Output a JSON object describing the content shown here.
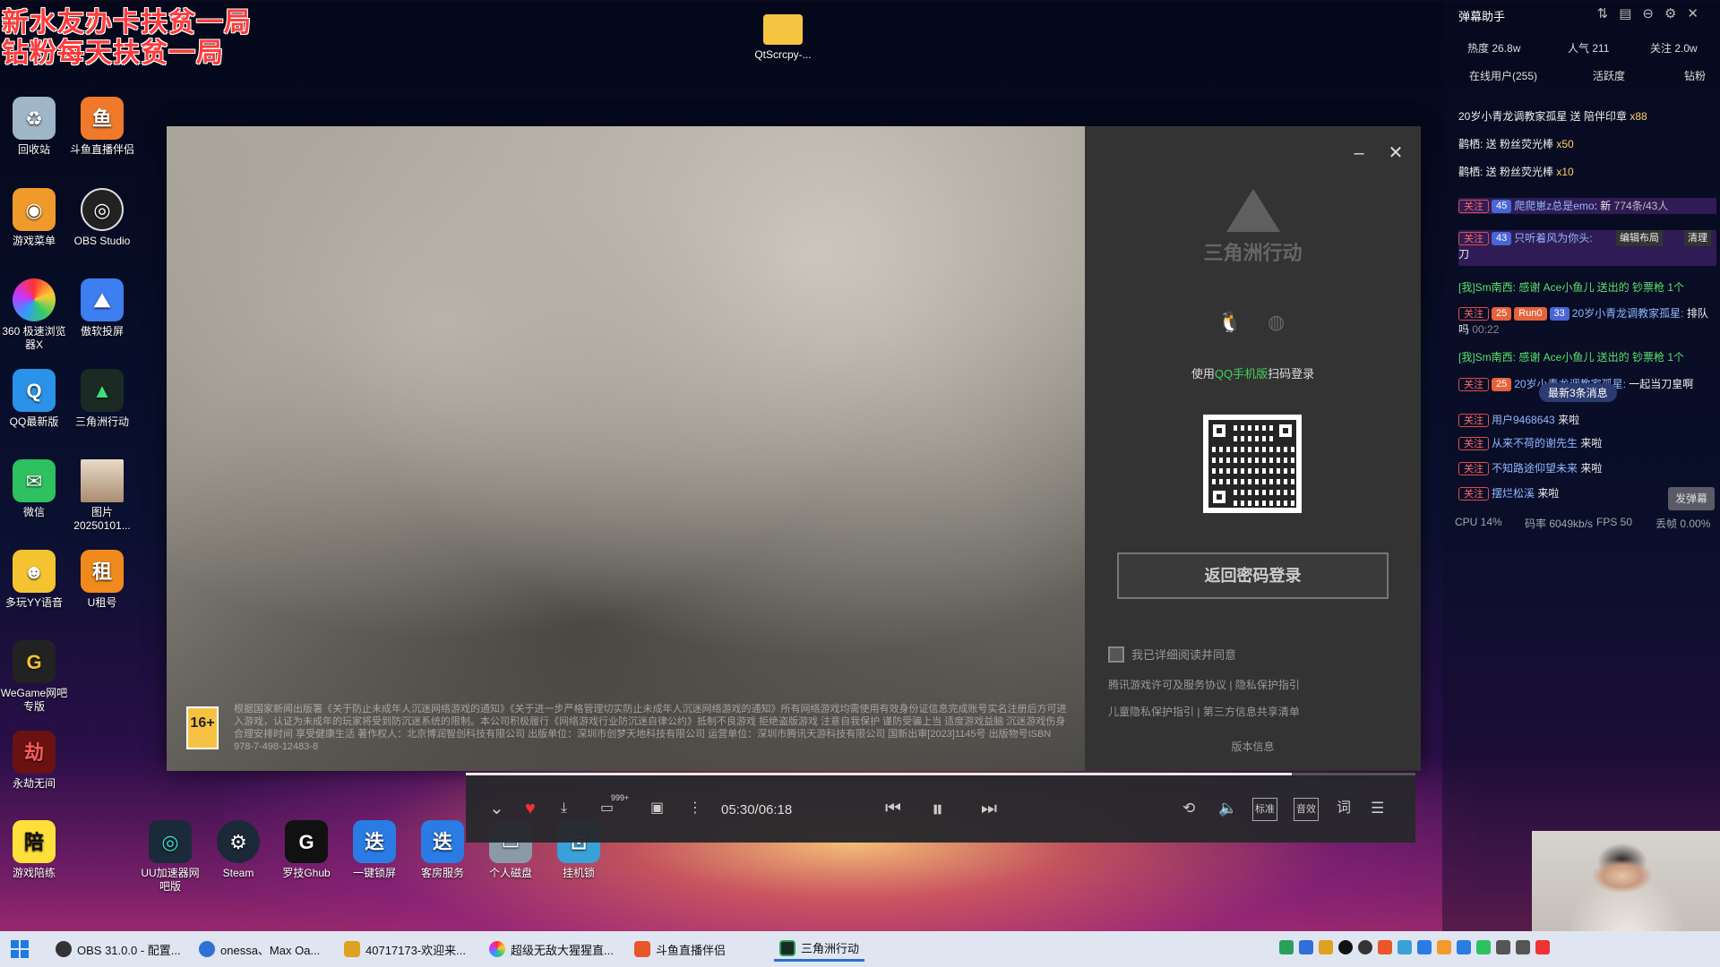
{
  "overlay": {
    "line1": "新水友办卡扶贫一局",
    "line2": "钻粉每天扶贫一局"
  },
  "desktop": {
    "folder_label": "QtScrcpy-...",
    "icons": [
      {
        "label": "回收站",
        "icon": "recycle-bin-icon"
      },
      {
        "label": "斗鱼直播伴侣",
        "icon": "douyu-icon"
      },
      {
        "label": "游戏菜单",
        "icon": "game-menu-icon"
      },
      {
        "label": "OBS Studio",
        "icon": "obs-icon"
      },
      {
        "label": "360 极速浏览器X",
        "icon": "browser-360-icon"
      },
      {
        "label": "傲软投屏",
        "icon": "apowermirror-icon"
      },
      {
        "label": "QQ最新版",
        "icon": "qq-icon"
      },
      {
        "label": "三角洲行动",
        "icon": "delta-force-icon"
      },
      {
        "label": "微信",
        "icon": "wechat-icon"
      },
      {
        "label": "图片 20250101...",
        "icon": "image-file-icon"
      },
      {
        "label": "多玩YY语音",
        "icon": "yy-icon"
      },
      {
        "label": "U租号",
        "icon": "u-rent-icon"
      },
      {
        "label": "WeGame网吧专版",
        "icon": "wegame-icon"
      },
      {
        "label": "永劫无间",
        "icon": "naraka-icon"
      },
      {
        "label": "游戏陪练",
        "icon": "game-coach-icon"
      },
      {
        "label": "UU加速器网吧版",
        "icon": "uu-accelerator-icon"
      },
      {
        "label": "Steam",
        "icon": "steam-icon"
      },
      {
        "label": "罗技Ghub",
        "icon": "logitech-ghub-icon"
      },
      {
        "label": "一键锁屏",
        "icon": "lock-screen-icon"
      },
      {
        "label": "客房服务",
        "icon": "room-service-icon"
      },
      {
        "label": "个人磁盘",
        "icon": "disk-icon"
      },
      {
        "label": "挂机锁",
        "icon": "afk-lock-icon"
      }
    ],
    "uu_badge": "网吧版"
  },
  "login": {
    "logo_text": "三角洲行动",
    "scan_prefix": "使用",
    "scan_highlight": "QQ手机版",
    "scan_suffix": "扫码登录",
    "password_button": "返回密码登录",
    "agree_text": "我已详细阅读并同意",
    "link1": "腾讯游戏许可及服务协议",
    "link2": "隐私保护指引",
    "link3": "儿童隐私保护指引",
    "link4": "第三方信息共享清单",
    "version": "版本信息",
    "age_badge": "16+",
    "notice": "根据国家新闻出版署《关于防止未成年人沉迷网络游戏的通知》《关于进一步严格管理切实防止未成年人沉迷网络游戏的通知》所有网络游戏均需使用有效身份证信息完成账号实名注册后方可进入游戏，认证为未成年的玩家将受到防沉迷系统的限制。本公司积极履行《网络游戏行业防沉迷自律公约》抵制不良游戏 拒绝盗版游戏 注意自我保护 谨防受骗上当 适度游戏益脑 沉迷游戏伤身 合理安排时间 享受健康生活 著作权人：北京博润智创科技有限公司 出版单位：深圳市创梦天地科技有限公司 运营单位：深圳市腾讯天游科技有限公司 国新出审[2023]1145号 出版物号ISBN 978-7-498-12483-8"
  },
  "player": {
    "time": "05:30/06:18",
    "progress": 0.87,
    "comment_badge": "999+",
    "quality_label": "标准",
    "effect_label": "音效",
    "lyrics_label": "词"
  },
  "chat": {
    "title": "弹幕助手",
    "heat": "热度 26.8w",
    "popularity": "人气 211",
    "follows": "关注 2.0w",
    "online": "在线用户(255)",
    "activity": "活跃度",
    "diamond": "钻粉",
    "messages": [
      {
        "text": "20岁小青龙调教家孤星 送 陪伴印章",
        "count": "x88"
      },
      {
        "text": "鹳栖: 送 粉丝荧光棒",
        "count": "x50"
      },
      {
        "text": "鹳栖: 送 粉丝荧光棒",
        "count": "x10"
      },
      {
        "user": "爬爬崽z总是emo",
        "text": "新",
        "extra": "774条/43人"
      },
      {
        "user": "只听着风为你头:",
        "text": "刀",
        "layout_btn": "编辑布局",
        "clear_btn": "清理"
      },
      {
        "text": "[我]Sm南西: 感谢 Ace小鱼儿 送出的 钞票枪 1个"
      },
      {
        "user": "20岁小青龙调教家孤星:",
        "text": "排队吗",
        "time": "00:22",
        "lv": "25",
        "name_tag": "Run0",
        "fan": "33"
      },
      {
        "text": "[我]Sm南西: 感谢 Ace小鱼儿 送出的 钞票枪 1个"
      },
      {
        "user": "20岁小青龙调教家孤星:",
        "text": "一起当刀皇啊"
      },
      {
        "user": "用户9468643",
        "text": "来啦"
      },
      {
        "user": "从来不荷的谢先生",
        "text": "来啦"
      },
      {
        "user": "不知路途仰望未来",
        "text": "来啦"
      },
      {
        "user": "摆烂松溪",
        "text": "来啦"
      }
    ],
    "follow_tag": "关注",
    "new_msgs": "最新3条消息",
    "send": "发弹幕",
    "cpu": "CPU 14%",
    "bitrate": "码率 6049kb/s",
    "fps": "FPS 50",
    "drop": "丢帧 0.00%"
  },
  "taskbar": {
    "items": [
      {
        "label": "OBS 31.0.0 - 配置...",
        "color": "#333333"
      },
      {
        "label": "onessa、Max Oa...",
        "color": "#2f6fd6"
      },
      {
        "label": "40717173-欢迎来...",
        "color": "#e0a020"
      },
      {
        "label": "超级无敌大猩猩直...",
        "color": "#d43fb0"
      },
      {
        "label": "斗鱼直播伴侣",
        "color": "#e8562a"
      },
      {
        "label": "三角洲行动",
        "color": "#2aa05a"
      }
    ]
  }
}
